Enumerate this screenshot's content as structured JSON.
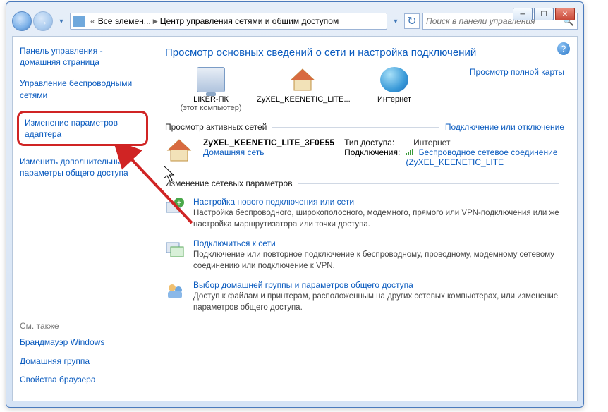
{
  "window": {
    "breadcrumb": {
      "root": "Все элемен...",
      "current": "Центр управления сетями и общим доступом"
    },
    "search_placeholder": "Поиск в панели управления"
  },
  "sidebar": {
    "items": [
      "Панель управления - домашняя страница",
      "Управление беспроводными сетями",
      "Изменение параметров адаптера",
      "Изменить дополнительные параметры общего доступа"
    ],
    "see_also_hdr": "См. также",
    "see_also": [
      "Брандмауэр Windows",
      "Домашняя группа",
      "Свойства браузера"
    ]
  },
  "main": {
    "heading": "Просмотр основных сведений о сети и настройка подключений",
    "map_link": "Просмотр полной карты",
    "nodes": [
      {
        "label": "LIKER-ПК",
        "sub": "(этот компьютер)"
      },
      {
        "label": "ZyXEL_KEENETIC_LITE...",
        "sub": ""
      },
      {
        "label": "Интернет",
        "sub": ""
      }
    ],
    "active_hdr": "Просмотр активных сетей",
    "active_link": "Подключение или отключение",
    "active_net": {
      "name": "ZyXEL_KEENETIC_LITE_3F0E55",
      "type": "Домашняя сеть",
      "access_type_label": "Тип доступа:",
      "access_type_val": "Интернет",
      "conn_label": "Подключения:",
      "conn_val": "Беспроводное сетевое соединение (ZyXEL_KEENETIC_LITE"
    },
    "change_hdr": "Изменение сетевых параметров",
    "change_items": [
      {
        "title": "Настройка нового подключения или сети",
        "desc": "Настройка беспроводного, широкополосного, модемного, прямого или VPN-подключения или же настройка маршрутизатора или точки доступа."
      },
      {
        "title": "Подключиться к сети",
        "desc": "Подключение или повторное подключение к беспроводному, проводному, модемному сетевому соединению или подключение к VPN."
      },
      {
        "title": "Выбор домашней группы и параметров общего доступа",
        "desc": "Доступ к файлам и принтерам, расположенным на других сетевых компьютерах, или изменение параметров общего доступа."
      }
    ]
  }
}
